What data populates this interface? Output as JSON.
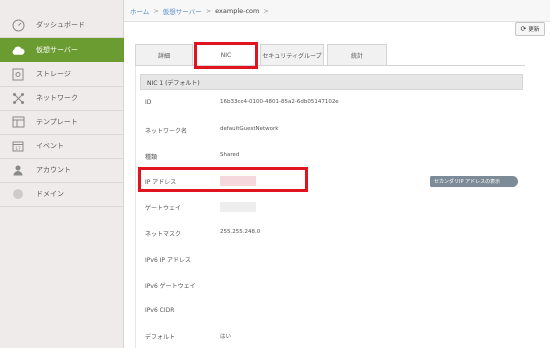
{
  "sidebar": {
    "items": [
      {
        "label": "ダッシュボード",
        "icon": "speedometer-icon",
        "active": false
      },
      {
        "label": "仮想サーバー",
        "icon": "cloud-icon",
        "active": true
      },
      {
        "label": "ストレージ",
        "icon": "storage-icon",
        "active": false
      },
      {
        "label": "ネットワーク",
        "icon": "network-icon",
        "active": false
      },
      {
        "label": "テンプレート",
        "icon": "template-icon",
        "active": false
      },
      {
        "label": "イベント",
        "icon": "calendar-icon",
        "active": false
      },
      {
        "label": "アカウント",
        "icon": "user-icon",
        "active": false
      },
      {
        "label": "ドメイン",
        "icon": "domain-icon",
        "active": false
      }
    ]
  },
  "breadcrumb": {
    "home": "ホーム",
    "servers": "仮想サーバー",
    "current": "example-com",
    "sep": ">"
  },
  "toolbar": {
    "refresh_label": "更新"
  },
  "tabs": [
    {
      "label": "詳細"
    },
    {
      "label": "NIC"
    },
    {
      "label": "セキュリティグループ"
    },
    {
      "label": "統計"
    }
  ],
  "nic": {
    "section_title": "NIC 1 (デフォルト)",
    "rows": [
      {
        "label": "ID",
        "value": "16b33cc4-0100-4801-85a2-6db05147102e"
      },
      {
        "label": "ネットワーク名",
        "value": "defaultGuestNetwork"
      },
      {
        "label": "種類",
        "value": "Shared"
      },
      {
        "label": "IP アドレス",
        "value": ""
      },
      {
        "label": "ゲートウェイ",
        "value": ""
      },
      {
        "label": "ネットマスク",
        "value": "255.255.248.0"
      },
      {
        "label": "IPv6 IP アドレス",
        "value": ""
      },
      {
        "label": "IPv6 ゲートウェイ",
        "value": ""
      },
      {
        "label": "IPv6 CIDR",
        "value": ""
      },
      {
        "label": "デフォルト",
        "value": "はい"
      }
    ],
    "secondary_ip_button": "セカンダリIP アドレスの表示"
  },
  "colors": {
    "accent": "#6a9c32",
    "highlight": "#e0141e",
    "link": "#5a8fc7",
    "button": "#7d8b99"
  }
}
